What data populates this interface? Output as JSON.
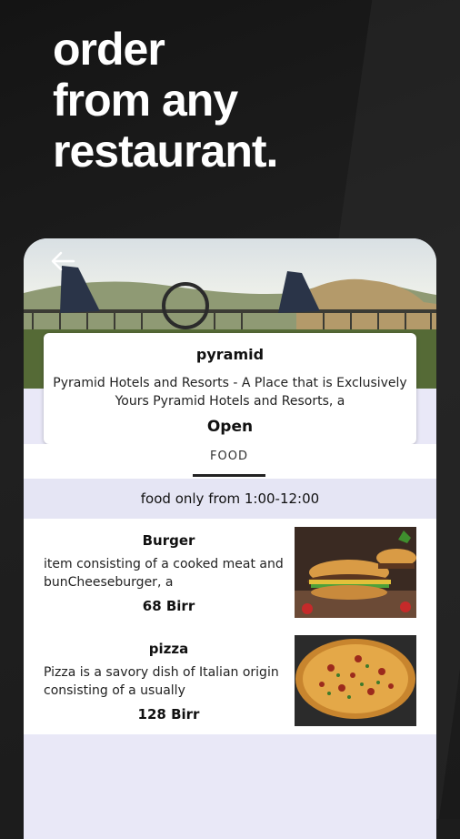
{
  "headline": {
    "line1": "order",
    "line2": "from any",
    "line3": "restaurant."
  },
  "restaurant": {
    "name": "pyramid",
    "description": "Pyramid Hotels and Resorts - A Place that is Exclusively Yours Pyramid Hotels and Resorts, a",
    "status": "Open"
  },
  "tabs": [
    {
      "label": "FOOD",
      "active": true
    }
  ],
  "hours_notice": "food only from 1:00-12:00",
  "menu": [
    {
      "name": "Burger",
      "description": "item consisting of a cooked meat and bunCheeseburger, a",
      "price": "68 Birr"
    },
    {
      "name": "pizza",
      "description": "Pizza is a savory dish of Italian origin consisting of a usually",
      "price": "128 Birr"
    }
  ],
  "icons": {
    "back": "arrow-left-icon"
  },
  "colors": {
    "background": "#1c1c1c",
    "headline": "#ffffff",
    "panel": "#e9e8f7",
    "card": "#ffffff"
  }
}
